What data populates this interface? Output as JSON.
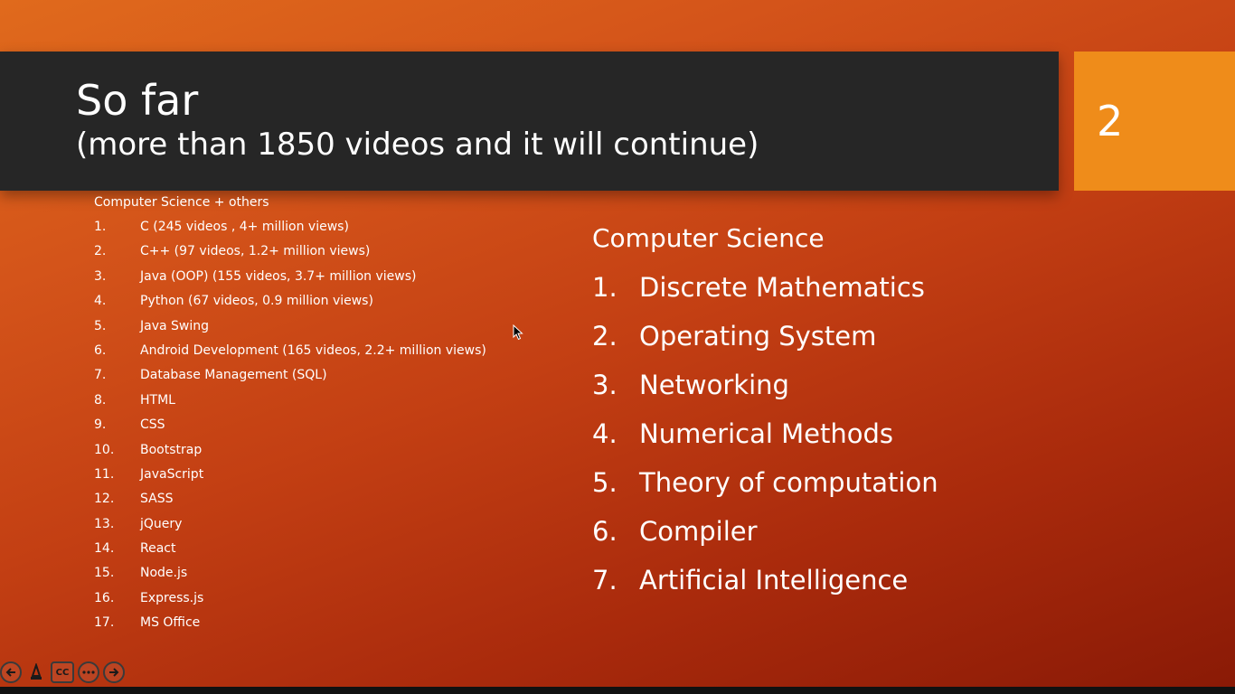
{
  "slide": {
    "title": "So far",
    "subtitle": "(more than 1850 videos and it will continue)",
    "slide_number": "2",
    "left_column": {
      "heading": "Computer Science + others",
      "items": [
        {
          "num": "1.",
          "text": "C  (245 videos , 4+ million views)"
        },
        {
          "num": "2.",
          "text": "C++ (97 videos, 1.2+ million views)"
        },
        {
          "num": "3.",
          "text": "Java (OOP) (155 videos, 3.7+ million views)"
        },
        {
          "num": "4.",
          "text": "Python (67 videos, 0.9 million views)"
        },
        {
          "num": "5.",
          "text": "Java Swing"
        },
        {
          "num": "6.",
          "text": "Android Development (165 videos, 2.2+ million views)"
        },
        {
          "num": "7.",
          "text": "Database Management (SQL)"
        },
        {
          "num": "8.",
          "text": "HTML"
        },
        {
          "num": "9.",
          "text": "CSS"
        },
        {
          "num": "10.",
          "text": "Bootstrap"
        },
        {
          "num": "11.",
          "text": "JavaScript"
        },
        {
          "num": "12.",
          "text": "SASS"
        },
        {
          "num": "13.",
          "text": "jQuery"
        },
        {
          "num": "14.",
          "text": "React"
        },
        {
          "num": "15.",
          "text": "Node.js"
        },
        {
          "num": "16.",
          "text": "Express.js"
        },
        {
          "num": "17.",
          "text": "MS Office"
        }
      ]
    },
    "right_column": {
      "heading": "Computer Science",
      "items": [
        {
          "num": "1.",
          "text": "Discrete Mathematics"
        },
        {
          "num": "2.",
          "text": "Operating System"
        },
        {
          "num": "3.",
          "text": "Networking"
        },
        {
          "num": "4.",
          "text": "Numerical Methods"
        },
        {
          "num": "5.",
          "text": "Theory of computation"
        },
        {
          "num": "6.",
          "text": "Compiler"
        },
        {
          "num": "7.",
          "text": "Artificial Intelligence"
        }
      ]
    }
  },
  "controls": {
    "icons": [
      "previous-icon",
      "pen-icon",
      "subtitles-icon",
      "more-icon",
      "next-icon"
    ],
    "cc_label": "CC"
  },
  "colors": {
    "background_start": "#e06a1c",
    "background_end": "#8a1a06",
    "title_bar": "#262626",
    "slide_number_box": "#ef8c1a",
    "text": "#ffffff"
  }
}
